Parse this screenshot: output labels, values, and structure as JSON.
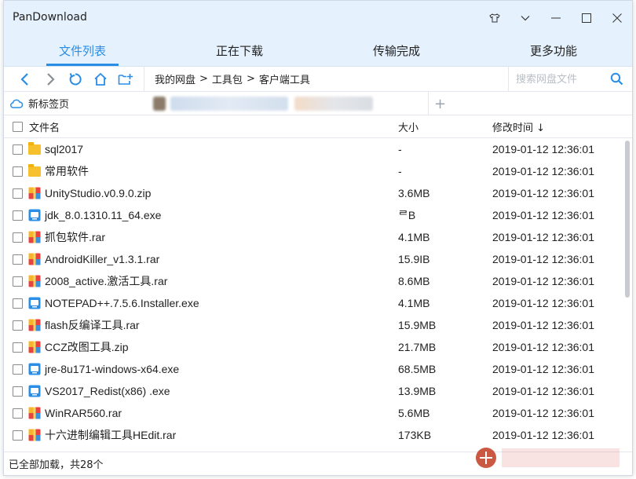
{
  "window": {
    "title": "PanDownload"
  },
  "tabs": [
    {
      "label": "文件列表",
      "active": true
    },
    {
      "label": "正在下载",
      "active": false
    },
    {
      "label": "传输完成",
      "active": false
    },
    {
      "label": "更多功能",
      "active": false
    }
  ],
  "toolbar": {
    "icons": [
      "back-icon",
      "forward-icon",
      "refresh-icon",
      "home-icon",
      "new-folder-icon"
    ],
    "breadcrumb": [
      "我的网盘",
      ">",
      "工具包",
      ">",
      "客户端工具"
    ],
    "search_placeholder": "搜索网盘文件"
  },
  "page_tab": {
    "label": "新标签页",
    "add_label": "+"
  },
  "table": {
    "headers": {
      "name": "文件名",
      "size": "大小",
      "time": "修改时间 ↓"
    },
    "rows": [
      {
        "name": "sql2017",
        "type": "folder",
        "size": "-",
        "time": "2019-01-12 12:36:01"
      },
      {
        "name": "常用软件",
        "type": "folder",
        "size": "-",
        "time": "2019-01-12 12:36:01"
      },
      {
        "name": "UnityStudio.v0.9.0.zip",
        "type": "archive",
        "size": "3.6MB",
        "time": "2019-01-12 12:36:01"
      },
      {
        "name": "jdk_8.0.1310.11_64.exe",
        "type": "exe",
        "size": "ᄅB",
        "time": "2019-01-12 12:36:01"
      },
      {
        "name": "抓包软件.rar",
        "type": "archive",
        "size": "4.1MB",
        "time": "2019-01-12 12:36:01"
      },
      {
        "name": "AndroidKiller_v1.3.1.rar",
        "type": "archive",
        "size": "15.9IB",
        "time": "2019-01-12 12:36:01"
      },
      {
        "name": "2008_active.激活工具.rar",
        "type": "archive",
        "size": "8.6MB",
        "time": "2019-01-12 12:36:01"
      },
      {
        "name": "NOTEPAD++.7.5.6.Installer.exe",
        "type": "exe",
        "size": "4.1MB",
        "time": "2019-01-12 12:36:01"
      },
      {
        "name": "flash反编译工具.rar",
        "type": "archive",
        "size": "15.9MB",
        "time": "2019-01-12 12:36:01"
      },
      {
        "name": "CCZ改图工具.zip",
        "type": "archive",
        "size": "21.7MB",
        "time": "2019-01-12 12:36:01"
      },
      {
        "name": "jre-8u171-windows-x64.exe",
        "type": "exe",
        "size": "68.5MB",
        "time": "2019-01-12 12:36:01"
      },
      {
        "name": "VS2017_Redist(x86) .exe",
        "type": "exe",
        "size": "13.9MB",
        "time": "2019-01-12 12:36:01"
      },
      {
        "name": "WinRAR560.rar",
        "type": "archive",
        "size": "5.6MB",
        "time": "2019-01-12 12:36:01"
      },
      {
        "name": "十六进制编辑工具HEdit.rar",
        "type": "archive",
        "size": "173KB",
        "time": "2019-01-12 12:36:01"
      }
    ]
  },
  "status": {
    "text": "已全部加载，共28个"
  },
  "colors": {
    "accent": "#2a8de6",
    "header_bg": "#e5f1fd",
    "folder": "#f7c12d"
  }
}
